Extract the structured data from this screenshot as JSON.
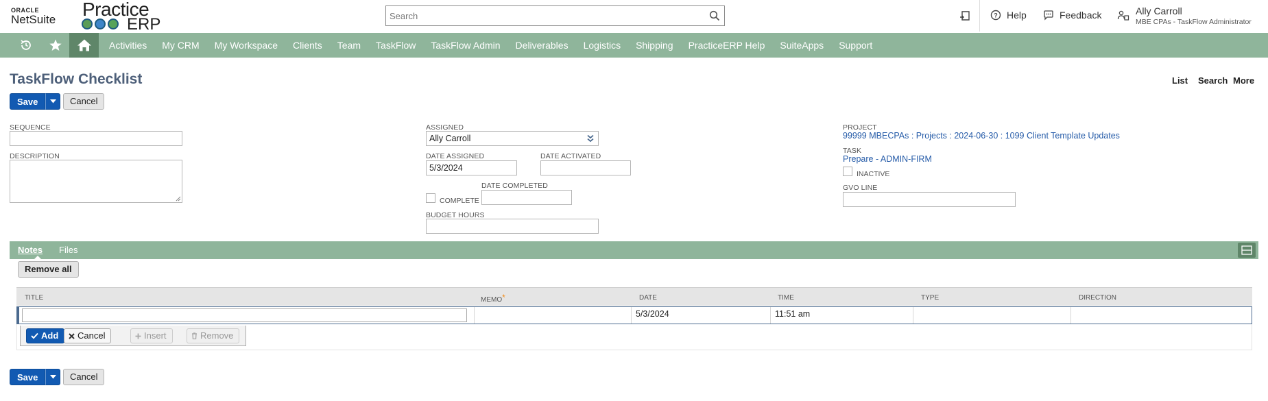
{
  "header": {
    "oracle_logo": "ORACLE",
    "netsuite_logo": "NetSuite",
    "practice_logo": "Practice",
    "erp_logo": "ERP",
    "search_placeholder": "Search",
    "help_label": "Help",
    "feedback_label": "Feedback",
    "user_name": "Ally Carroll",
    "user_role": "MBE CPAs - TaskFlow Administrator"
  },
  "nav": {
    "items": [
      "Activities",
      "My CRM",
      "My Workspace",
      "Clients",
      "Team",
      "TaskFlow",
      "TaskFlow Admin",
      "Deliverables",
      "Logistics",
      "Shipping",
      "PracticeERP Help",
      "SuiteApps",
      "Support"
    ],
    "bg_color": "#8fb59b",
    "home_color": "#5f8669"
  },
  "page": {
    "title": "TaskFlow Checklist",
    "links": {
      "list": "List",
      "search": "Search",
      "more": "More"
    },
    "save_label": "Save",
    "cancel_label": "Cancel"
  },
  "form": {
    "sequence_label": "SEQUENCE",
    "sequence_value": "",
    "description_label": "DESCRIPTION",
    "assigned_label": "ASSIGNED",
    "assigned_value": "Ally Carroll",
    "date_assigned_label": "DATE ASSIGNED",
    "date_assigned_value": "5/3/2024",
    "date_activated_label": "DATE ACTIVATED",
    "date_activated_value": "",
    "complete_label": "COMPLETE",
    "complete_checked": false,
    "date_completed_label": "DATE COMPLETED",
    "date_completed_value": "",
    "budget_hours_label": "BUDGET HOURS",
    "budget_hours_value": "",
    "project_label": "PROJECT",
    "project_value": "99999 MBECPAs : Projects : 2024-06-30 : 1099 Client Template Updates",
    "task_label": "TASK",
    "task_value": "Prepare - ADMIN-FIRM",
    "inactive_label": "INACTIVE",
    "inactive_checked": false,
    "gvo_line_label": "GVO LINE",
    "gvo_line_value": ""
  },
  "subtabs": {
    "notes_label": "Notes",
    "files_label": "Files",
    "remove_all_label": "Remove all"
  },
  "notes_table": {
    "columns": [
      "TITLE",
      "MEMO",
      "DATE",
      "TIME",
      "TYPE",
      "DIRECTION"
    ],
    "row": {
      "title": "",
      "memo": "",
      "date": "5/3/2024",
      "time": "11:51 am",
      "type": "",
      "direction": ""
    },
    "add_label": "Add",
    "cancel_label": "Cancel",
    "insert_label": "Insert",
    "remove_label": "Remove"
  },
  "colors": {
    "primary_button": "#125ab2",
    "title_color": "#4d5f79",
    "link_color": "#255ba8",
    "required_star": "#f28c1a"
  }
}
